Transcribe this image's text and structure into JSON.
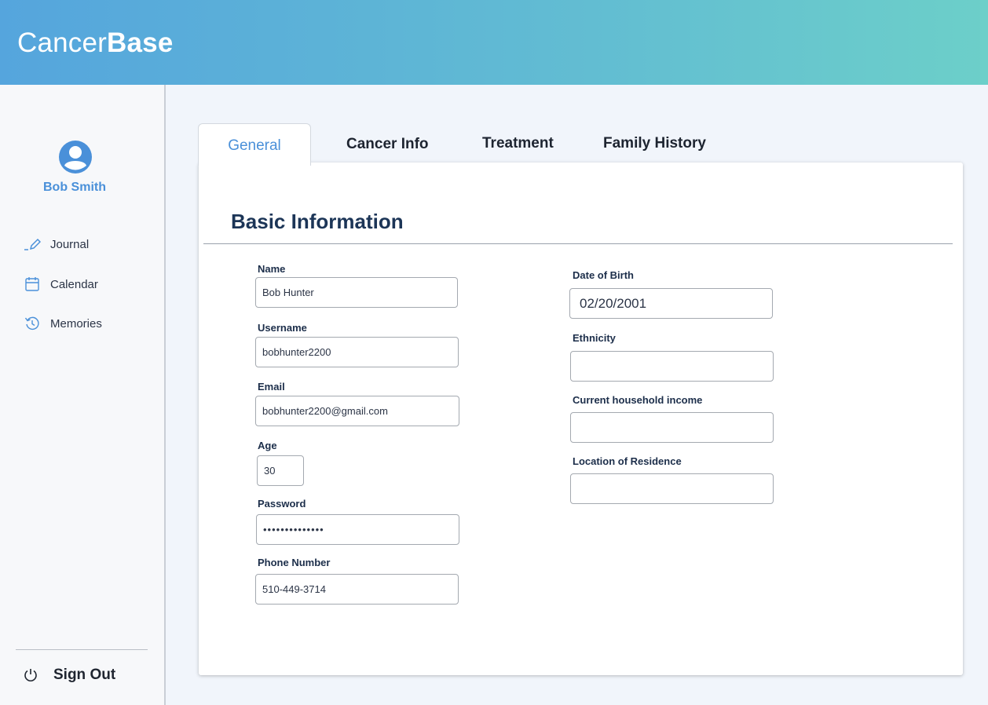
{
  "app": {
    "brand_light": "Cancer",
    "brand_bold": "Base"
  },
  "colors": {
    "accent": "#4a90d9",
    "header_start": "#55a5dd",
    "header_end": "#6ccfc9",
    "title": "#1c3557"
  },
  "sidebar": {
    "user_name": "Bob Smith",
    "items": [
      {
        "label": "Journal",
        "icon": "pencil-icon"
      },
      {
        "label": "Calendar",
        "icon": "calendar-icon"
      },
      {
        "label": "Memories",
        "icon": "history-icon"
      }
    ],
    "signout_label": "Sign Out"
  },
  "tabs": [
    {
      "label": "General",
      "active": true
    },
    {
      "label": "Cancer Info",
      "active": false
    },
    {
      "label": "Treatment",
      "active": false
    },
    {
      "label": "Family History",
      "active": false
    }
  ],
  "form": {
    "section_title": "Basic Information",
    "fields": {
      "name": {
        "label": "Name",
        "value": "Bob Hunter"
      },
      "username": {
        "label": "Username",
        "value": "bobhunter2200"
      },
      "email": {
        "label": "Email",
        "value": "bobhunter2200@gmail.com"
      },
      "age": {
        "label": "Age",
        "value": "30"
      },
      "password": {
        "label": "Password",
        "value": "••••••••••••••"
      },
      "phone": {
        "label": "Phone Number",
        "value": "510-449-3714"
      },
      "dob": {
        "label": "Date of Birth",
        "value": "02/20/2001"
      },
      "ethnicity": {
        "label": "Ethnicity",
        "value": ""
      },
      "income": {
        "label": "Current household income",
        "value": ""
      },
      "location": {
        "label": "Location of Residence",
        "value": ""
      }
    }
  }
}
